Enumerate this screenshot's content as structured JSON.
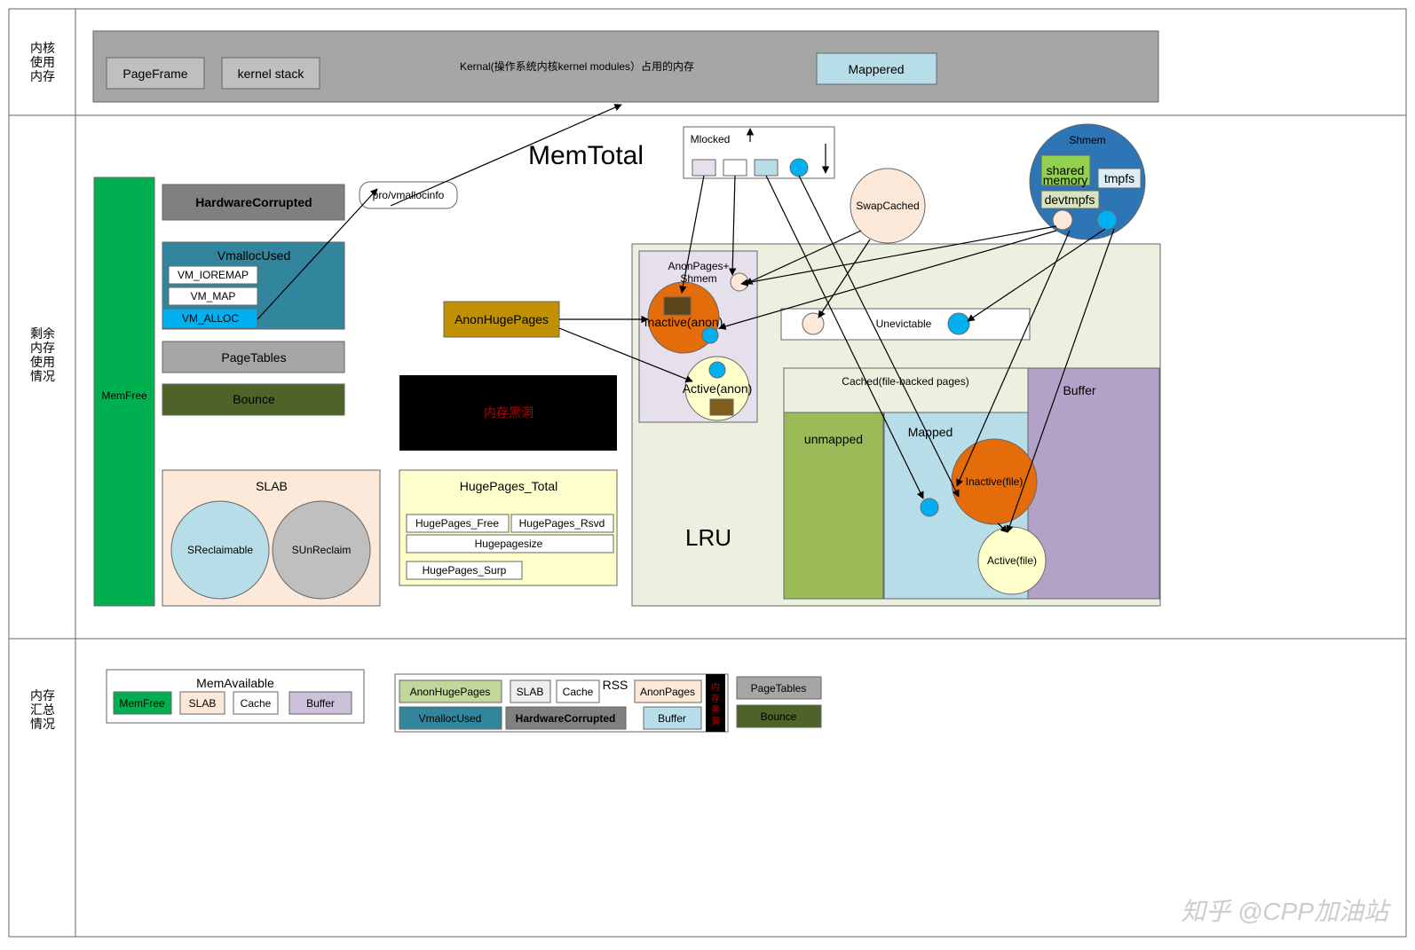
{
  "rows": {
    "kernel": "内核\n使用\n内存",
    "remain": "剩余\n内存\n使用\n情况",
    "summary": "内存\n汇总\n情况"
  },
  "kernel": {
    "page_frame": "PageFrame",
    "kstack": "kernel stack",
    "note": "Kernal(操作系统内核kernel modules）占用的内存",
    "mappered": "Mappered"
  },
  "memtotal": "MemTotal",
  "memfree": "MemFree",
  "hw": "HardwareCorrupted",
  "vmalloc": "VmallocUsed",
  "vm1": "VM_IOREMAP",
  "vm2": "VM_MAP",
  "vm3": "VM_ALLOC",
  "proc": "pro/vmallocinfo",
  "pagetables": "PageTables",
  "bounce": "Bounce",
  "blackhole": "内存黑洞",
  "anonhuge": "AnonHugePages",
  "slab": "SLAB",
  "sreclaim": "SReclaimable",
  "sunreclaim": "SUnReclaim",
  "huge": {
    "title": "HugePages_Total",
    "free": "HugePages_Free",
    "rsvd": "HugePages_Rsvd",
    "size": "Hugepagesize",
    "surp": "HugePages_Surp"
  },
  "lru": "LRU",
  "anonpages": "AnonPages+\nShmem",
  "inactive_anon": "Inactive(anon)",
  "active_anon": "Active(anon)",
  "mlocked": "Mlocked",
  "swapcached": "SwapCached",
  "unevictable": "Unevictable",
  "cached": "Cached(file-backed pages)",
  "unmapped": "unmapped",
  "mapped": "Mapped",
  "buffer": "Buffer",
  "inactive_file": "Inactive(file)",
  "active_file": "Active(file)",
  "shmem": "Shmem",
  "shared_mem": "shared\nmemory",
  "tmpfs": "tmpfs",
  "devtmpfs": "devtmpfs",
  "memavailable": "MemAvailable",
  "rss": "RSS",
  "sum": {
    "memfree": "MemFree",
    "slab": "SLAB",
    "cache": "Cache",
    "buffer": "Buffer",
    "anonhuge": "AnonHugePages",
    "slab2": "SLAB",
    "cache2": "Cache",
    "anonpages": "AnonPages",
    "vmalloc": "VmallocUsed",
    "hw": "HardwareCorrupted",
    "buffer2": "Buffer",
    "blackhole": "内\n存\n黑\n洞",
    "pagetables": "PageTables",
    "bounce": "Bounce"
  },
  "watermark": "知乎 @CPP加油站"
}
